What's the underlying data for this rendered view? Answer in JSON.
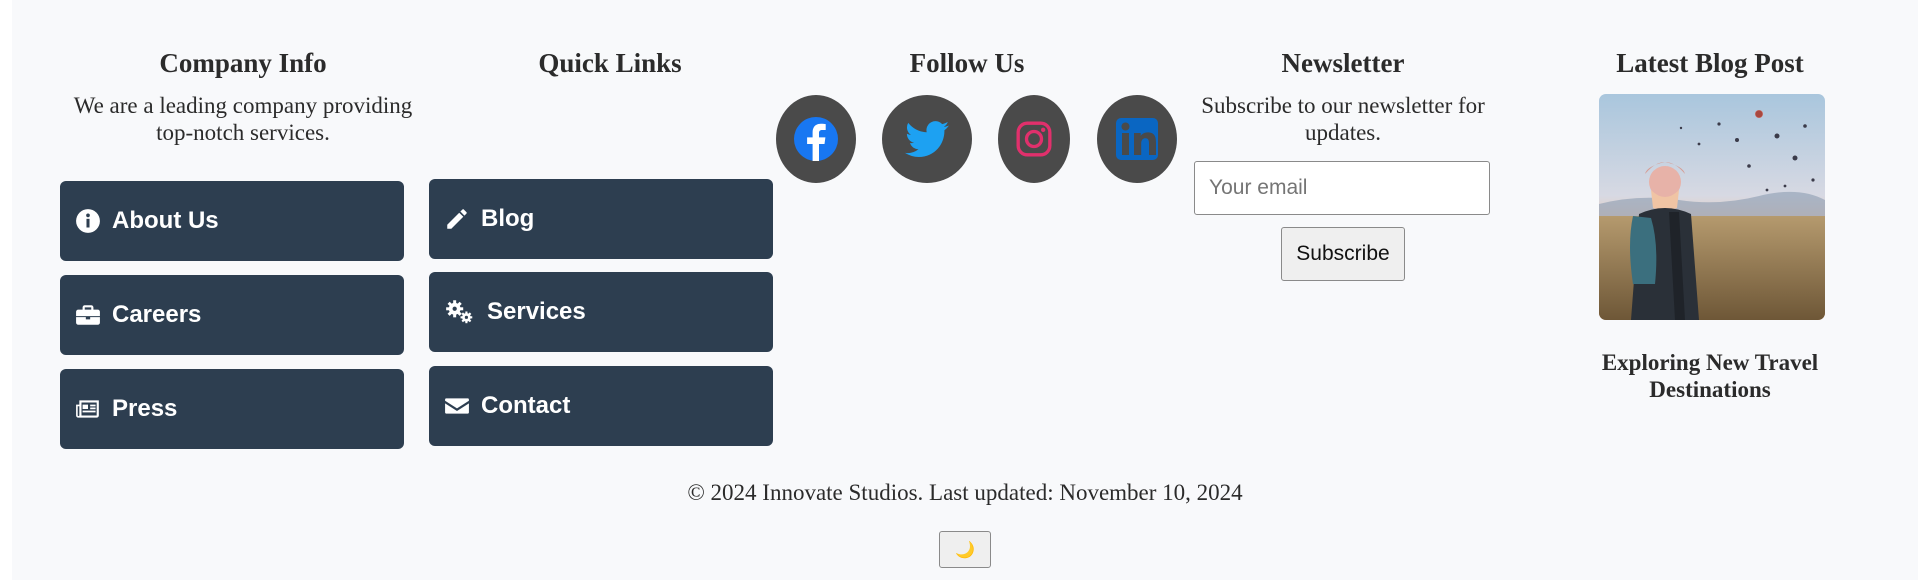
{
  "company_info": {
    "heading": "Company Info",
    "description": "We are a leading company providing top-notch services.",
    "buttons": [
      {
        "label": "About Us",
        "icon": "info-circle-icon"
      },
      {
        "label": "Careers",
        "icon": "briefcase-icon"
      },
      {
        "label": "Press",
        "icon": "newspaper-icon"
      }
    ]
  },
  "quick_links": {
    "heading": "Quick Links",
    "buttons": [
      {
        "label": "Blog",
        "icon": "pencil-icon"
      },
      {
        "label": "Services",
        "icon": "cogs-icon"
      },
      {
        "label": "Contact",
        "icon": "envelope-icon"
      }
    ]
  },
  "follow_us": {
    "heading": "Follow Us",
    "networks": [
      {
        "icon": "facebook-icon",
        "color": "#1877f2"
      },
      {
        "icon": "twitter-icon",
        "color": "#1da1f2"
      },
      {
        "icon": "instagram-icon",
        "color": "#e1306c"
      },
      {
        "icon": "linkedin-icon",
        "color": "#0a66c2"
      }
    ]
  },
  "newsletter": {
    "heading": "Newsletter",
    "description": "Subscribe to our newsletter for updates.",
    "email_placeholder": "Your email",
    "subscribe_label": "Subscribe"
  },
  "latest_blog": {
    "heading": "Latest Blog Post",
    "post_title": "Exploring New Travel Destinations"
  },
  "footer": {
    "copyright": "© 2024 Innovate Studios. Last updated: November 10, 2024",
    "theme_toggle_icon": "🌙"
  },
  "colors": {
    "button_bg": "#2d3e50",
    "footer_bg": "#f8f9fb",
    "social_bg": "#4a4a4a"
  }
}
